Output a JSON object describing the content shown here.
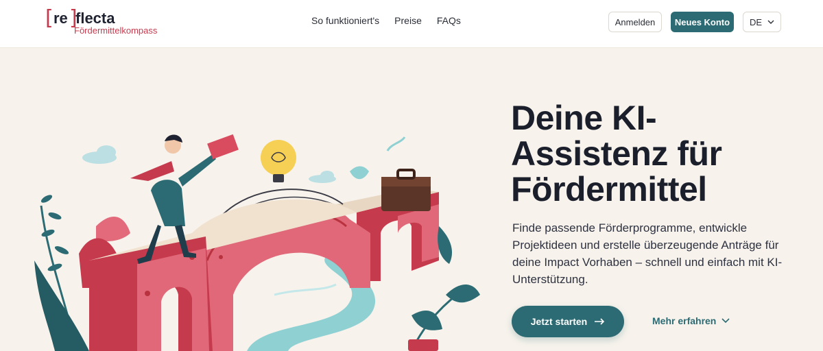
{
  "header": {
    "logo": {
      "bracket_open": "[",
      "re": "re",
      "bracket_close": "]",
      "word": "flecta",
      "subtitle": "Fördermittelkompass"
    },
    "nav": [
      {
        "label": "So funktioniert's"
      },
      {
        "label": "Preise"
      },
      {
        "label": "FAQs"
      }
    ],
    "login_label": "Anmelden",
    "new_account_label": "Neues Konto",
    "language": "DE"
  },
  "hero": {
    "title": "Deine KI-Assistenz für Fördermittel",
    "description": "Finde passende Förderprogramme, entwickle Projektideen und erstelle überzeugende Anträge für deine Impact Vorhaben – schnell und einfach mit KI-Unterstützung.",
    "cta_primary": "Jetzt starten",
    "cta_secondary": "Mehr erfahren"
  },
  "icons": {
    "arrow": "arrow-right-icon",
    "chevron": "chevron-down-icon"
  },
  "colors": {
    "accent": "#2c6b73",
    "brand_red": "#c63a4e",
    "background": "#f7f3ec"
  }
}
